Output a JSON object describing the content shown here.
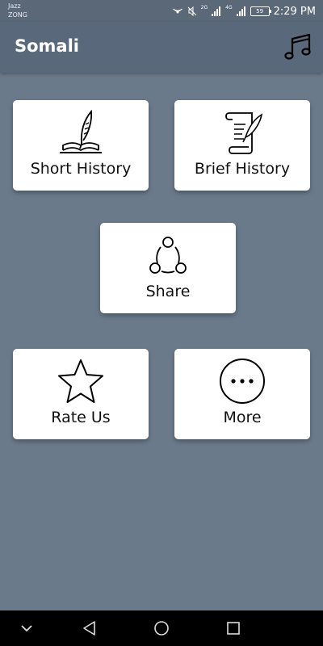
{
  "status": {
    "carrier_line1": "Jazz",
    "carrier_line2": "ZONG",
    "battery": "59",
    "time": "2:29 PM",
    "net1": "2G",
    "net2": "4G"
  },
  "appbar": {
    "title": "Somali",
    "music_icon": "music-note-icon"
  },
  "cards": {
    "short_history": {
      "label": "Short History",
      "icon": "quill-book-icon"
    },
    "brief_history": {
      "label": "Brief History",
      "icon": "scroll-quill-icon"
    },
    "share": {
      "label": "Share",
      "icon": "share-icon"
    },
    "rate_us": {
      "label": "Rate Us",
      "icon": "star-icon"
    },
    "more": {
      "label": "More",
      "icon": "more-dots-icon"
    }
  },
  "navbar": {
    "icons": [
      "chevron-down-icon",
      "back-triangle-icon",
      "home-circle-icon",
      "recents-square-icon"
    ]
  },
  "colors": {
    "background": "#6b7a8b",
    "appbar": "#59687a",
    "card": "#ffffff"
  }
}
